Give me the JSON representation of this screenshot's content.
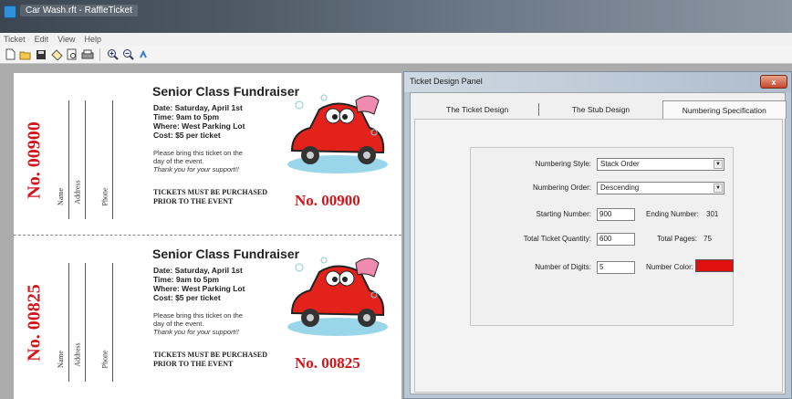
{
  "window": {
    "title": "Car Wash.rft - RaffleTicket"
  },
  "menu": [
    "Ticket",
    "Edit",
    "View",
    "Help"
  ],
  "toolbar": [
    "new-icon",
    "open-icon",
    "save-icon",
    "ticket-icon",
    "print-preview-icon",
    "print-icon",
    "zoom-in-icon",
    "zoom-out-icon",
    "help-icon"
  ],
  "tickets": [
    {
      "stub_number": "No. 00900",
      "stub_fields": [
        "Name",
        "Address",
        "Phone"
      ],
      "title": "Senior Class Fundraiser",
      "details": [
        "Date: Saturday, April 1st",
        "Time: 9am to 5pm",
        "Where: West Parking Lot",
        "Cost: $5 per ticket"
      ],
      "note_lines": [
        "Please bring this ticket on the",
        "day of the event."
      ],
      "thanks": "Thank you for your support!!",
      "warning_lines": [
        "TICKETS MUST BE PURCHASED",
        "PRIOR TO THE EVENT"
      ],
      "number": "No. 00900"
    },
    {
      "stub_number": "No. 00825",
      "stub_fields": [
        "Name",
        "Address",
        "Phone"
      ],
      "title": "Senior Class Fundraiser",
      "details": [
        "Date: Saturday, April 1st",
        "Time: 9am to 5pm",
        "Where: West Parking Lot",
        "Cost: $5 per ticket"
      ],
      "note_lines": [
        "Please bring this ticket on the",
        "day of the event."
      ],
      "thanks": "Thank you for your support!!",
      "warning_lines": [
        "TICKETS MUST BE PURCHASED",
        "PRIOR TO THE EVENT"
      ],
      "number": "No. 00825"
    }
  ],
  "dialog": {
    "title": "Ticket Design Panel",
    "close_label": "x",
    "tabs": [
      "The Ticket Design",
      "The Stub Design",
      "Numbering Specification"
    ],
    "active_tab": 2,
    "numbering": {
      "style_label": "Numbering Style:",
      "style_value": "Stack Order",
      "order_label": "Numbering Order:",
      "order_value": "Descending",
      "start_label": "Starting Number:",
      "start_value": "900",
      "ending_label": "Ending Number:",
      "ending_value": "301",
      "quantity_label": "Total Ticket Quantity:",
      "quantity_value": "600",
      "pages_label": "Total Pages:",
      "pages_value": "75",
      "digits_label": "Number of Digits:",
      "digits_value": "5",
      "color_label": "Number Color:",
      "color_value": "#e01010"
    }
  },
  "colors": {
    "ticket_number": "#d2141b"
  }
}
